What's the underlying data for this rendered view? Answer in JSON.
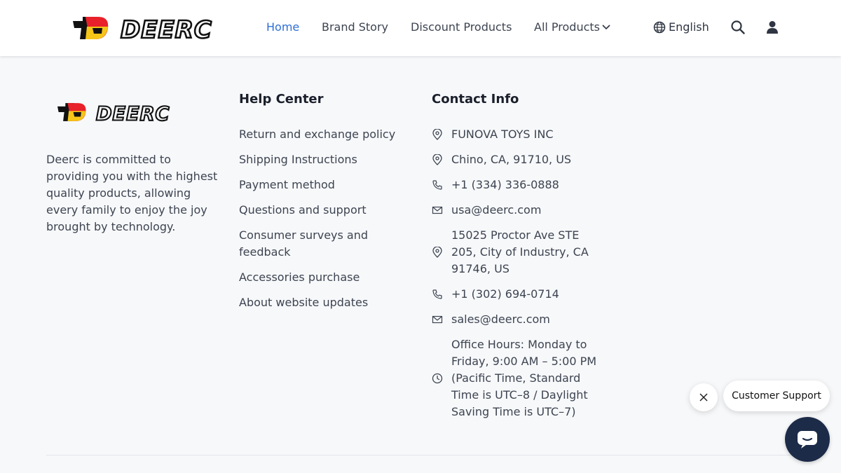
{
  "brand": {
    "logo_text": "DEERC",
    "accent_red": "#e8212a",
    "accent_yellow": "#f5c518",
    "dark": "#111111"
  },
  "nav": {
    "home": "Home",
    "brand_story": "Brand Story",
    "discount_products": "Discount Products",
    "all_products": "All Products",
    "active_color": "#2e6fd6"
  },
  "header_actions": {
    "language": "English",
    "search_icon": "search-icon",
    "user_icon": "user-icon",
    "globe_icon": "globe-icon"
  },
  "footer": {
    "about": "Deerc is committed to providing you with the highest quality products, allowing every family to enjoy the joy brought by technology.",
    "help_center": {
      "title": "Help Center",
      "items": [
        "Return and exchange policy",
        "Shipping Instructions",
        "Payment method",
        "Questions and support",
        "Consumer surveys and feedback",
        "Accessories purchase",
        "About website updates"
      ]
    },
    "contact": {
      "title": "Contact Info",
      "items": [
        {
          "icon": "location-icon",
          "text": "FUNOVA TOYS INC"
        },
        {
          "icon": "location-icon",
          "text": "Chino, CA, 91710, US"
        },
        {
          "icon": "phone-icon",
          "text": "+1 (334) 336-0888"
        },
        {
          "icon": "mail-icon",
          "text": "usa@deerc.com"
        },
        {
          "icon": "location-icon",
          "text": "15025 Proctor Ave STE 205, City of Industry, CA 91746, US"
        },
        {
          "icon": "phone-icon",
          "text": "+1 (302) 694-0714"
        },
        {
          "icon": "mail-icon",
          "text": "sales@deerc.com"
        },
        {
          "icon": "clock-icon",
          "text": "Office Hours: Monday to Friday, 9:00 AM – 5:00 PM (Pacific Time, Standard Time is UTC–8 / Daylight Saving Time is UTC–7)"
        }
      ]
    }
  },
  "support": {
    "label": "Customer Support",
    "chat_color": "#1c2b48"
  }
}
